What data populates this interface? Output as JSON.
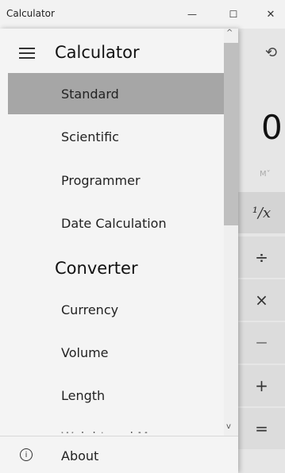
{
  "window": {
    "title": "Calculator",
    "minimize_glyph": "—",
    "maximize_glyph": "☐",
    "close_glyph": "✕"
  },
  "nav": {
    "title": "Calculator",
    "items": [
      {
        "label": "Standard",
        "selected": true
      },
      {
        "label": "Scientific"
      },
      {
        "label": "Programmer"
      },
      {
        "label": "Date Calculation"
      }
    ],
    "section": "Converter",
    "converter_items": [
      {
        "label": "Currency"
      },
      {
        "label": "Volume"
      },
      {
        "label": "Length"
      }
    ],
    "cut_item": "Weight and Mass",
    "footer": {
      "about": "About",
      "info_glyph": "i"
    },
    "scroll_up_glyph": "^",
    "scroll_down_glyph": "v"
  },
  "calc": {
    "display": "0",
    "memory_label": "M˅",
    "keys": [
      "¹/x",
      "÷",
      "×",
      "—",
      "+",
      "="
    ],
    "history_glyph": "⟲"
  }
}
